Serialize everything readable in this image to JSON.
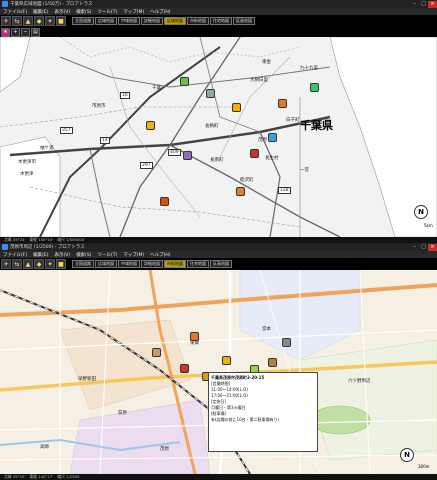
{
  "top_window": {
    "title": "千葉県広域地図 (1/50万) - プロアトラス",
    "menu": [
      "ファイル(F)",
      "編集(E)",
      "表示(V)",
      "検索(S)",
      "ツール(T)",
      "マップ(M)",
      "ヘルプ(H)"
    ],
    "tabs": [
      "全国道路",
      "広域地図",
      "中域地図",
      "詳細地図",
      "広域地図",
      "市街地図",
      "住宅地図",
      "区画地図"
    ],
    "active_tab_index": 4,
    "prefecture_label": "千葉県",
    "place_labels": [
      "市原市",
      "千葉",
      "木更津市",
      "木更津",
      "袖ケ浦",
      "長柄町",
      "白子町",
      "茂原",
      "長南町",
      "睦沢町",
      "一宮",
      "長生村",
      "大網白里",
      "東金",
      "九十九里"
    ],
    "route_numbers": [
      "16",
      "297",
      "409",
      "128",
      "14",
      "357"
    ],
    "scale_text": "5km",
    "compass": "N",
    "status": [
      "北緯 35°24'",
      "東経 140°10'",
      "縮尺 1/500000"
    ]
  },
  "bottom_window": {
    "title": "茂原市周辺 (1/2500) - プロアトラス",
    "menu": [
      "ファイル(F)",
      "編集(E)",
      "表示(V)",
      "検索(S)",
      "ツール(T)",
      "マップ(M)",
      "ヘルプ(H)"
    ],
    "tabs": [
      "全国道路",
      "広域地図",
      "中域地図",
      "詳細地図",
      "市街地図",
      "住宅地図",
      "区画地図"
    ],
    "active_tab_index": 4,
    "place_labels": [
      "宮本",
      "東郷",
      "早野新田",
      "荻原",
      "六ツ野周辺",
      "茂原",
      "高師"
    ],
    "popup": {
      "header": "千葉県茂原市茂原町3-20-15",
      "lines": [
        "[営業時間]",
        "11:00～14:00(L.O)",
        "17:00～21:00(L.O)",
        "[定休日]",
        "月曜日・第3火曜日",
        "[駐車場]",
        "有(店舗の前に10台・第二駐車場有り)"
      ]
    },
    "scale_text": "300m",
    "compass": "N",
    "status": [
      "北緯 35°25'",
      "東経 140°17'",
      "縮尺 1/2500"
    ]
  },
  "colors": {
    "active_tab": "#b8a000",
    "popup_bg": "#ffffff",
    "map_top": "#f2f2f2",
    "map_bottom": "#f6efe4"
  }
}
